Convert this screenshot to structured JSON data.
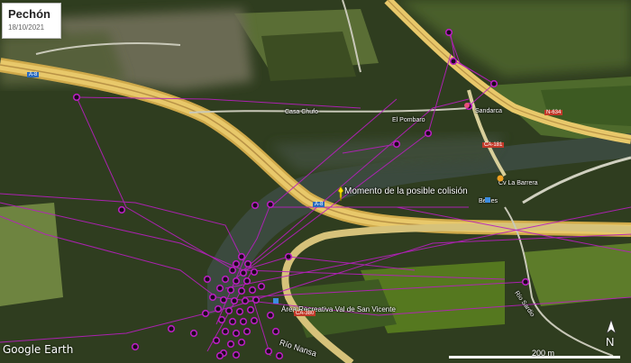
{
  "header": {
    "title": "Pechón",
    "date": "18/10/2021"
  },
  "labels": {
    "collision_point": "Momento de la posible colisión",
    "casa_chufo": "Casa Chufo",
    "el_pombaro": "El Pombaro",
    "sandarca": "Sandarca",
    "cv_la_barrera": "Cv La Barrera",
    "besies": "Besies",
    "area_recreativa": "Área Recreativa Val de San Vicente",
    "rio_nansa": "Río Nansa",
    "rio_sardio": "Río Sardio"
  },
  "road_shields": {
    "a8_top": "A-8",
    "a8_mid": "A-8",
    "n634": "N-634",
    "ca181": "CA-181",
    "ca380": "CA-380"
  },
  "footer": {
    "attribution": "Google Earth",
    "scale_label": "200 m",
    "north_label": "N"
  },
  "icons": {
    "collision": "yellow-pushpin-icon",
    "waypoint": "magenta-circle-icon",
    "north": "north-arrow-icon",
    "marker": "orange-marker-icon"
  },
  "colors": {
    "track": "#b81fbf",
    "highway": "#e8c86a",
    "pin": "#ffe600"
  }
}
